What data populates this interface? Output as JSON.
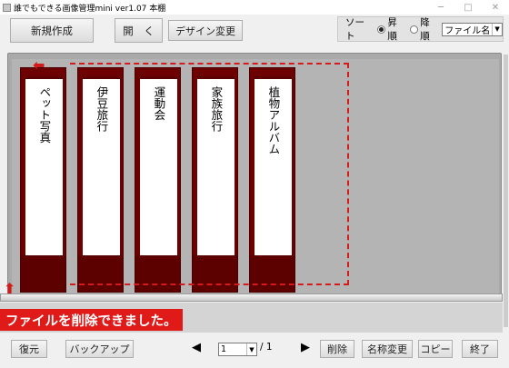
{
  "window": {
    "title": "誰でもできる画像管理mini ver1.07 本棚",
    "minimize": "─",
    "maximize": "□",
    "close": "✕"
  },
  "toolbar": {
    "new_label": "新規作成",
    "open_label": "開　く",
    "design_label": "デザイン変更"
  },
  "sort": {
    "label": "ソート",
    "ascending": "昇順",
    "descending": "降順",
    "selected_key": "ファイル名",
    "order": "ascending"
  },
  "binders": [
    {
      "label": "ペット写真"
    },
    {
      "label": "伊豆旅行"
    },
    {
      "label": "運動会"
    },
    {
      "label": "家族旅行"
    },
    {
      "label": "植物アルバム"
    }
  ],
  "message": "ファイルを削除できました。",
  "footer": {
    "restore_label": "復元",
    "backup_label": "バックアップ",
    "prev_icon": "◀",
    "next_icon": "▶",
    "page_current": "1",
    "page_total": "/ 1",
    "delete_label": "削除",
    "rename_label": "名称変更",
    "copy_label": "コピー",
    "exit_label": "終了"
  },
  "colors": {
    "binder": "#6d0000",
    "highlight": "#d41a1a",
    "shelf": "#a9a9a9"
  }
}
